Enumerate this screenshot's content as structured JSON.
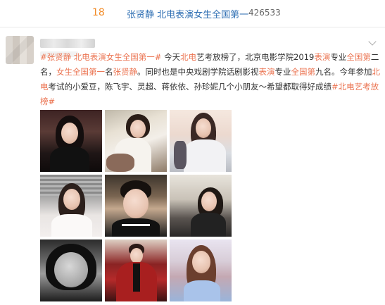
{
  "hot_item": {
    "rank": "18",
    "title": "张贤静 北电表演女生全国第一",
    "count": "426533"
  },
  "post": {
    "segments": [
      {
        "text": "#张贤静 北电表演女生全国第一#",
        "type": "tag"
      },
      {
        "text": " 今天",
        "type": "plain"
      },
      {
        "text": "北电",
        "type": "hl"
      },
      {
        "text": "艺考放榜了，北京电影学院2019",
        "type": "plain"
      },
      {
        "text": "表演",
        "type": "hl"
      },
      {
        "text": "专业",
        "type": "plain"
      },
      {
        "text": "全国第",
        "type": "hl"
      },
      {
        "text": "二名，",
        "type": "plain"
      },
      {
        "text": "女生全国第一",
        "type": "hl"
      },
      {
        "text": "名",
        "type": "plain"
      },
      {
        "text": "张贤静",
        "type": "hl"
      },
      {
        "text": "。同时也是中央戏剧学院话剧影视",
        "type": "plain"
      },
      {
        "text": "表演",
        "type": "hl"
      },
      {
        "text": "专业",
        "type": "plain"
      },
      {
        "text": "全国第",
        "type": "hl"
      },
      {
        "text": "九名。今年参加",
        "type": "plain"
      },
      {
        "text": "北电",
        "type": "hl"
      },
      {
        "text": "考试的小爱豆，陈飞宇、灵超、蒋依依、孙珍妮几个小朋友～希望都取得好成绩",
        "type": "plain"
      },
      {
        "text": "#北电艺考放榜#",
        "type": "tag"
      }
    ],
    "photos": [
      {
        "name": "photo-1"
      },
      {
        "name": "photo-2"
      },
      {
        "name": "photo-3"
      },
      {
        "name": "photo-4"
      },
      {
        "name": "photo-5"
      },
      {
        "name": "photo-6"
      },
      {
        "name": "photo-7"
      },
      {
        "name": "photo-8"
      },
      {
        "name": "photo-9"
      }
    ]
  },
  "icons": {
    "more": "chevron-down-icon"
  },
  "colors": {
    "tag": "#eb7350",
    "title_link": "#2f6fb3",
    "rank": "#f28c28"
  }
}
